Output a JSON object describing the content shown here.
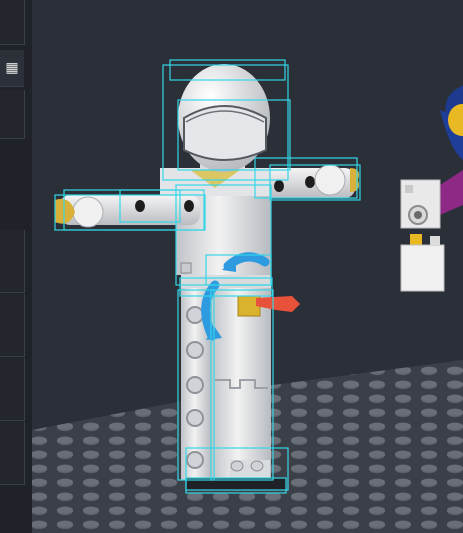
{
  "toolbar": {
    "grid_toggle_icon": "grid-icon",
    "grid_toggle_glyph": "▦"
  },
  "scene": {
    "background_color": "#2b2f38",
    "baseplate_color": "#3a3f47",
    "stud_color": "#5a5f68",
    "selection_color": "#35d6e6",
    "rotate_gizmo_color": "#2e9be0",
    "move_gizmo_color": "#e8513a",
    "minifig_body_color": "#e6e6e6",
    "hand_color": "#d8b13a",
    "pins_color": "#b0b0b0"
  }
}
